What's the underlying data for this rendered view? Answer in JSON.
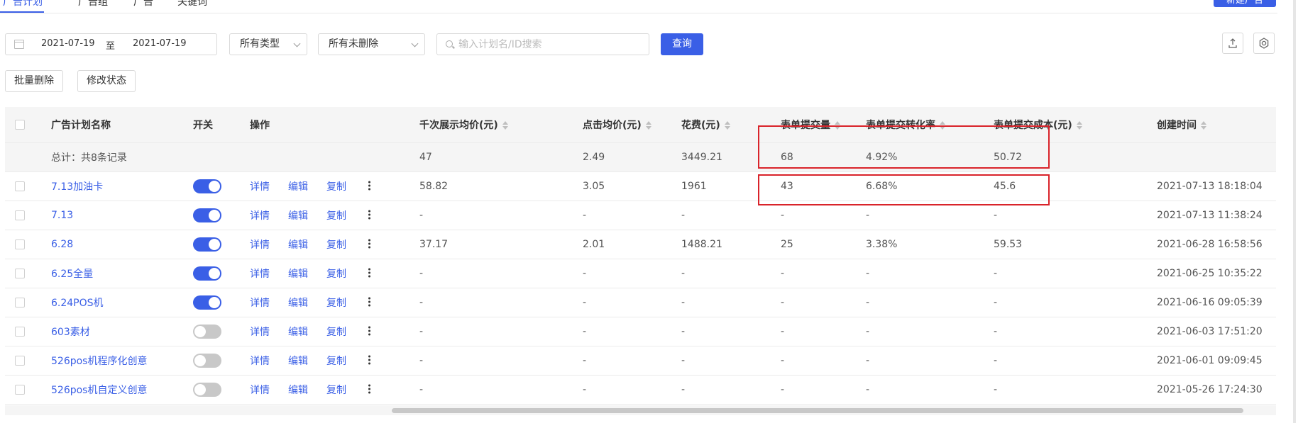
{
  "tabs": [
    {
      "label": "广告计划",
      "active": true
    },
    {
      "label": "广告组",
      "active": false
    },
    {
      "label": "广告",
      "active": false
    },
    {
      "label": "关键词",
      "active": false
    }
  ],
  "new_button_label": "新建广告",
  "filters": {
    "date_start": "2021-07-19",
    "date_sep": "至",
    "date_end": "2021-07-19",
    "type_select": "所有类型",
    "status_select": "所有未删除",
    "search_placeholder": "输入计划名/ID搜索",
    "search_value": "",
    "query_label": "查询"
  },
  "toolbar": {
    "batch_delete_label": "批量删除",
    "modify_status_label": "修改状态"
  },
  "table": {
    "headers": {
      "name": "广告计划名称",
      "switch": "开关",
      "ops": "操作",
      "cpm": "千次展示均价(元)",
      "cpc": "点击均价(元)",
      "cost": "花费(元)",
      "submit": "表单提交量",
      "rate": "表单提交转化率",
      "cpa": "表单提交成本(元)",
      "created": "创建时间"
    },
    "total": {
      "label": "总计：共8条记录",
      "cpm": "47",
      "cpc": "2.49",
      "cost": "3449.21",
      "submit": "68",
      "rate": "4.92%",
      "cpa": "50.72"
    },
    "op_labels": {
      "detail": "详情",
      "edit": "编辑",
      "copy": "复制"
    },
    "rows": [
      {
        "name": "7.13加油卡",
        "on": true,
        "cpm": "58.82",
        "cpc": "3.05",
        "cost": "1961",
        "submit": "43",
        "rate": "6.68%",
        "cpa": "45.6",
        "created": "2021-07-13 18:18:04"
      },
      {
        "name": "7.13",
        "on": true,
        "cpm": "-",
        "cpc": "-",
        "cost": "-",
        "submit": "-",
        "rate": "-",
        "cpa": "-",
        "created": "2021-07-13 11:38:24"
      },
      {
        "name": "6.28",
        "on": true,
        "cpm": "37.17",
        "cpc": "2.01",
        "cost": "1488.21",
        "submit": "25",
        "rate": "3.38%",
        "cpa": "59.53",
        "created": "2021-06-28 16:58:56"
      },
      {
        "name": "6.25全量",
        "on": true,
        "cpm": "-",
        "cpc": "-",
        "cost": "-",
        "submit": "-",
        "rate": "-",
        "cpa": "-",
        "created": "2021-06-25 10:35:22"
      },
      {
        "name": "6.24POS机",
        "on": true,
        "cpm": "-",
        "cpc": "-",
        "cost": "-",
        "submit": "-",
        "rate": "-",
        "cpa": "-",
        "created": "2021-06-16 09:05:39"
      },
      {
        "name": "603素材",
        "on": false,
        "cpm": "-",
        "cpc": "-",
        "cost": "-",
        "submit": "-",
        "rate": "-",
        "cpa": "-",
        "created": "2021-06-03 17:51:20"
      },
      {
        "name": "526pos机程序化创意",
        "on": false,
        "cpm": "-",
        "cpc": "-",
        "cost": "-",
        "submit": "-",
        "rate": "-",
        "cpa": "-",
        "created": "2021-06-01 09:09:45"
      },
      {
        "name": "526pos机自定义创意",
        "on": false,
        "cpm": "-",
        "cpc": "-",
        "cost": "-",
        "submit": "-",
        "rate": "-",
        "cpa": "-",
        "created": "2021-05-26 17:24:30"
      }
    ]
  },
  "colors": {
    "accent": "#3a5fe6",
    "highlight_box": "#d9232a"
  },
  "icons": {
    "date": "calendar-icon",
    "search": "search-icon",
    "export": "export-icon",
    "settings": "gear-icon",
    "more": "more-vertical-icon"
  }
}
